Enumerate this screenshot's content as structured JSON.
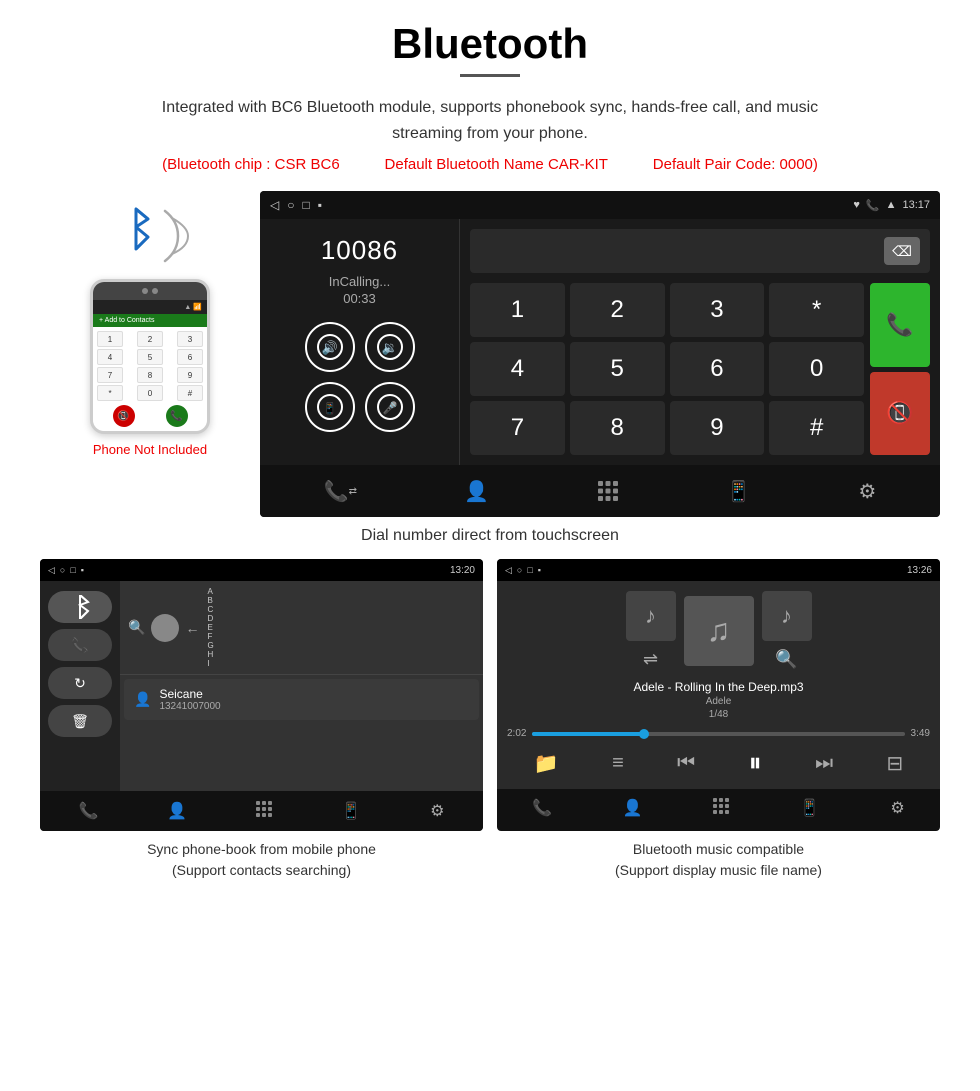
{
  "header": {
    "title": "Bluetooth",
    "description": "Integrated with BC6 Bluetooth module, supports phonebook sync, hands-free call, and music streaming from your phone.",
    "specs": {
      "chip": "(Bluetooth chip : CSR BC6",
      "name": "Default Bluetooth Name CAR-KIT",
      "code": "Default Pair Code: 0000)"
    }
  },
  "main_screen": {
    "status_bar": {
      "left_icons": [
        "◁",
        "○",
        "□",
        "▪"
      ],
      "right_icons": [
        "♥",
        "📞",
        "▲"
      ],
      "time": "13:17"
    },
    "dial_number": "10086",
    "call_status": "InCalling...",
    "call_timer": "00:33",
    "dialpad_keys": [
      "1",
      "2",
      "3",
      "*",
      "4",
      "5",
      "6",
      "0",
      "7",
      "8",
      "9",
      "#"
    ],
    "caption": "Dial number direct from touchscreen"
  },
  "phone_not_included": "Phone Not Included",
  "bottom_left": {
    "caption_line1": "Sync phone-book from mobile phone",
    "caption_line2": "(Support contacts searching)",
    "contact_name": "Seicane",
    "contact_phone": "13241007000",
    "status_bar_time": "13:20"
  },
  "bottom_right": {
    "caption_line1": "Bluetooth music compatible",
    "caption_line2": "(Support display music file name)",
    "song_title": "Adele - Rolling In the Deep.mp3",
    "artist": "Adele",
    "track_count": "1/48",
    "time_current": "2:02",
    "time_total": "3:49",
    "status_bar_time": "13:26"
  },
  "icons": {
    "bluetooth": "✱",
    "phone": "📞",
    "volume_up": "🔊",
    "volume_down": "🔉",
    "transfer": "📲",
    "mic": "🎤",
    "call_active": "📞",
    "call_end": "📵",
    "contacts": "👤",
    "dialpad_grid": "⊞",
    "settings_gear": "⚙",
    "transfer_call": "⇄",
    "search": "🔍",
    "shuffle": "⇌",
    "prev": "⏮",
    "play_pause": "⏸",
    "next": "⏭",
    "equalizer": "⊟"
  }
}
